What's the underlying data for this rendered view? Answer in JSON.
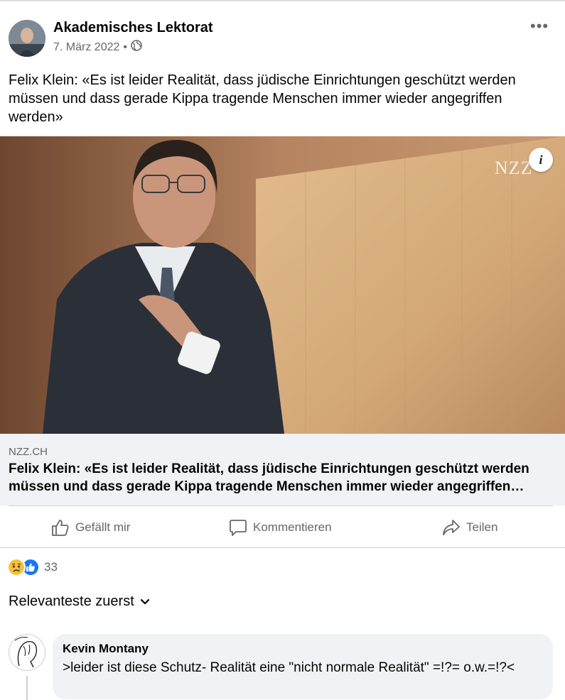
{
  "post": {
    "author": "Akademisches Lektorat",
    "date": "7. März 2022",
    "separator": "•",
    "audience_icon": "globe-icon",
    "more_icon": "more-icon",
    "more_label": "•••",
    "text": "Felix Klein: «Es ist leider Realität, dass jüdische Einrichtungen geschützt werden müssen und dass gerade Kippa tragende Menschen immer wieder angegriffen werden»"
  },
  "image": {
    "watermark": "NZZ",
    "info_label": "i"
  },
  "link": {
    "domain": "NZZ.CH",
    "title": "Felix Klein: «Es ist leider Realität, dass jüdische Einrichtungen geschützt werden müssen und dass gerade Kippa tragende Menschen immer wieder angegriffen…"
  },
  "actions": {
    "like": "Gefällt mir",
    "comment": "Kommentieren",
    "share": "Teilen"
  },
  "reactions": {
    "types": [
      "sad",
      "like"
    ],
    "count": "33"
  },
  "sort": {
    "label": "Relevanteste zuerst"
  },
  "comment": {
    "author": "Kevin Montany",
    "text": ">leider ist diese Schutz- Realität eine \"nicht normale Realität\" =!?= o.w.=!?<"
  },
  "colors": {
    "text": "#050505",
    "secondary": "#65676b",
    "link_bg": "#f0f2f5",
    "like_blue": "#1877f2",
    "sad_yellow": "#f7c23a"
  }
}
